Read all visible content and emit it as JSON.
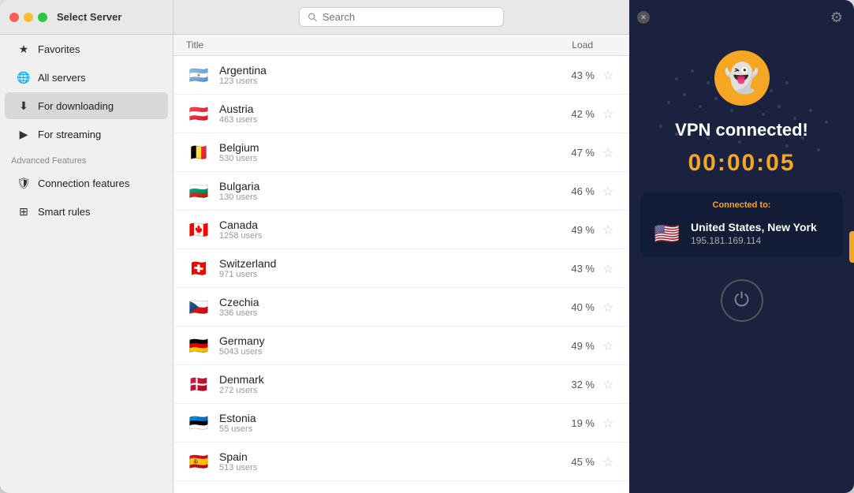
{
  "sidebar": {
    "title": "Select Server",
    "items": [
      {
        "id": "favorites",
        "label": "Favorites",
        "icon": "★"
      },
      {
        "id": "all-servers",
        "label": "All servers",
        "icon": "🌐"
      },
      {
        "id": "for-downloading",
        "label": "For downloading",
        "icon": "⬇",
        "active": true
      },
      {
        "id": "for-streaming",
        "label": "For streaming",
        "icon": "▶"
      }
    ],
    "advanced_label": "Advanced Features",
    "advanced_items": [
      {
        "id": "connection-features",
        "label": "Connection features",
        "icon": "🛡"
      },
      {
        "id": "smart-rules",
        "label": "Smart rules",
        "icon": "⊞"
      }
    ]
  },
  "search": {
    "placeholder": "Search"
  },
  "table": {
    "col_title": "Title",
    "col_load": "Load"
  },
  "servers": [
    {
      "country": "Argentina",
      "users": "123 users",
      "load": "43 %",
      "flag": "🇦🇷"
    },
    {
      "country": "Austria",
      "users": "463 users",
      "load": "42 %",
      "flag": "🇦🇹"
    },
    {
      "country": "Belgium",
      "users": "530 users",
      "load": "47 %",
      "flag": "🇧🇪"
    },
    {
      "country": "Bulgaria",
      "users": "130 users",
      "load": "46 %",
      "flag": "🇧🇬"
    },
    {
      "country": "Canada",
      "users": "1258 users",
      "load": "49 %",
      "flag": "🇨🇦"
    },
    {
      "country": "Switzerland",
      "users": "971 users",
      "load": "43 %",
      "flag": "🇨🇭"
    },
    {
      "country": "Czechia",
      "users": "336 users",
      "load": "40 %",
      "flag": "🇨🇿"
    },
    {
      "country": "Germany",
      "users": "5043 users",
      "load": "49 %",
      "flag": "🇩🇪"
    },
    {
      "country": "Denmark",
      "users": "272 users",
      "load": "32 %",
      "flag": "🇩🇰"
    },
    {
      "country": "Estonia",
      "users": "55 users",
      "load": "19 %",
      "flag": "🇪🇪"
    },
    {
      "country": "Spain",
      "users": "513 users",
      "load": "45 %",
      "flag": "🇪🇸"
    }
  ],
  "vpn": {
    "status": "VPN connected!",
    "timer": "00:00:05",
    "connected_label": "Connected to:",
    "server_name": "United States, New York",
    "server_ip": "195.181.169.114",
    "server_flag": "🇺🇸"
  },
  "icons": {
    "gear": "⚙",
    "power": "⏻",
    "chevron": "»",
    "search": "🔍",
    "star_empty": "☆",
    "star_filled": "★",
    "close": "✕"
  }
}
